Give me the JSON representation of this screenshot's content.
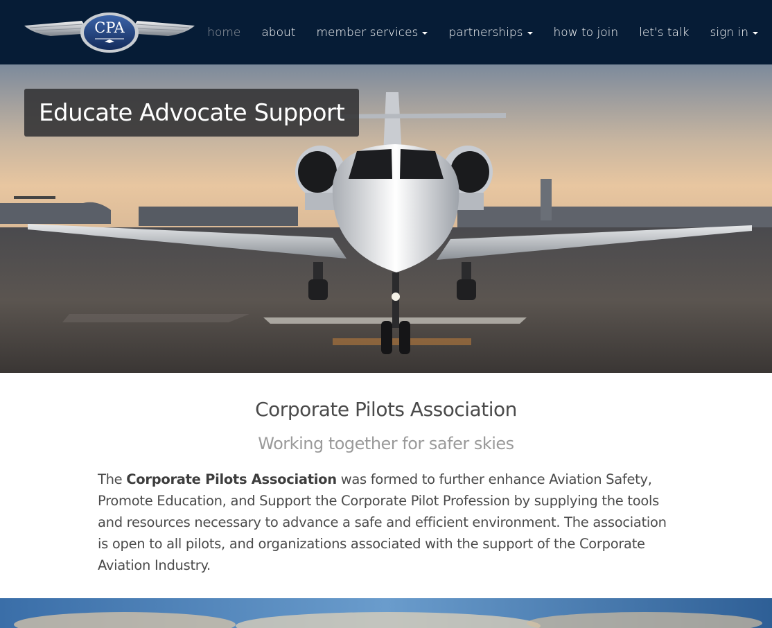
{
  "nav": {
    "logo_text": "CPA",
    "items": [
      {
        "label": "home",
        "active": true,
        "dropdown": false
      },
      {
        "label": "about",
        "active": false,
        "dropdown": false
      },
      {
        "label": "member services",
        "active": false,
        "dropdown": true
      },
      {
        "label": "partnerships",
        "active": false,
        "dropdown": true
      },
      {
        "label": "how to join",
        "active": false,
        "dropdown": false
      },
      {
        "label": "let's talk",
        "active": false,
        "dropdown": false
      },
      {
        "label": "sign in",
        "active": false,
        "dropdown": true
      }
    ]
  },
  "hero": {
    "tagline": "Educate Advocate Support"
  },
  "intro": {
    "title": "Corporate Pilots Association",
    "subtitle": "Working together for safer skies",
    "body_prefix": "The ",
    "body_bold": "Corporate Pilots Association",
    "body_rest": " was formed to further enhance Aviation Safety, Promote Education, and Support the Corporate Pilot Profession by supplying the tools and resources necessary to advance a safe and efficient environment. The association is open to all pilots, and organizations associated with the support of the Corporate Aviation Industry."
  },
  "colors": {
    "navbar_bg": "#061c36",
    "nav_active": "#9a9ea5",
    "text_dark": "#4a4a4a",
    "text_muted": "#9a9a9a"
  }
}
